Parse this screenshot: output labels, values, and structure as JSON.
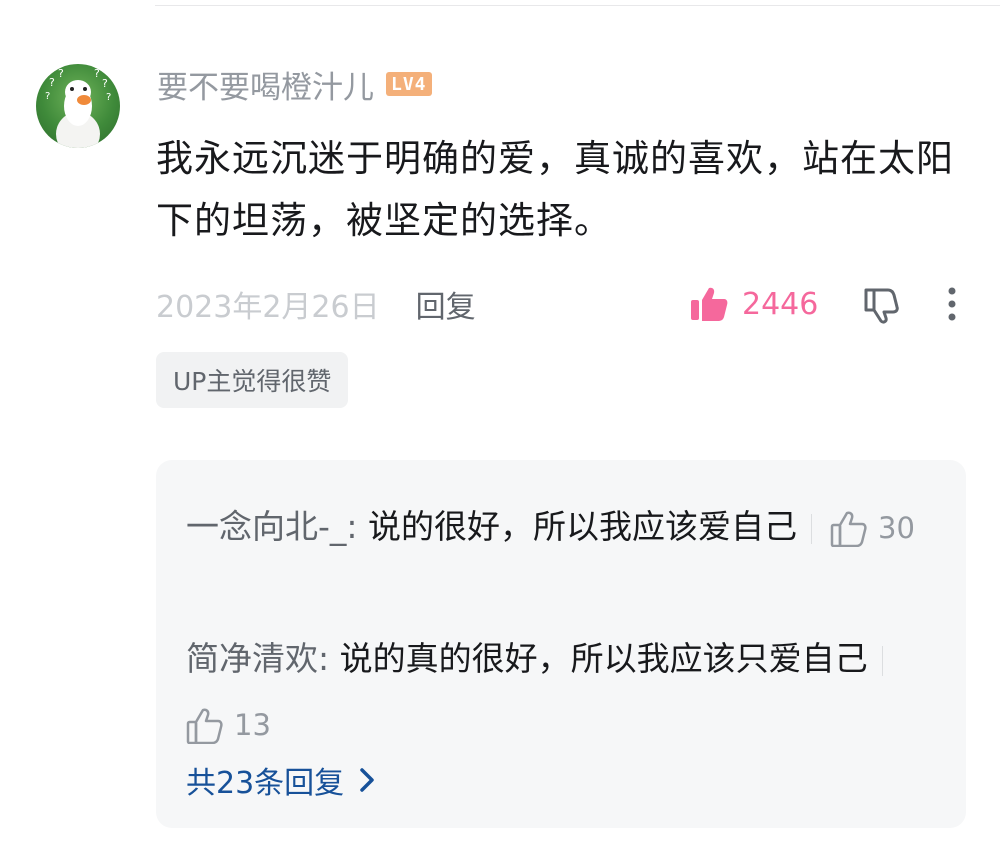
{
  "comment": {
    "username": "要不要喝橙汁儿",
    "level": "LV4",
    "text": "我永远沉迷于明确的爱，真诚的喜欢，站在太阳下的坦荡，被坚定的选择。",
    "date": "2023年2月26日",
    "reply_label": "回复",
    "like_count": "2446",
    "up_tag": "UP主觉得很赞"
  },
  "replies": [
    {
      "username": "一念向北-_",
      "text": "说的很好，所以我应该爱自己",
      "like_count": "30"
    },
    {
      "username": "简净清欢",
      "text": "说的真的很好，所以我应该只爱自己",
      "like_count": "13"
    }
  ],
  "view_all_replies": "共23条回复",
  "colors": {
    "like_active": "#f5689c",
    "link": "#175199",
    "muted": "#9499a0",
    "level_badge": "#f4b07a"
  },
  "icons": {
    "avatar": "goose-avatar",
    "like": "thumbs-up-icon",
    "dislike": "thumbs-down-icon",
    "more": "vertical-dots-icon",
    "chevron": "chevron-right-icon"
  }
}
